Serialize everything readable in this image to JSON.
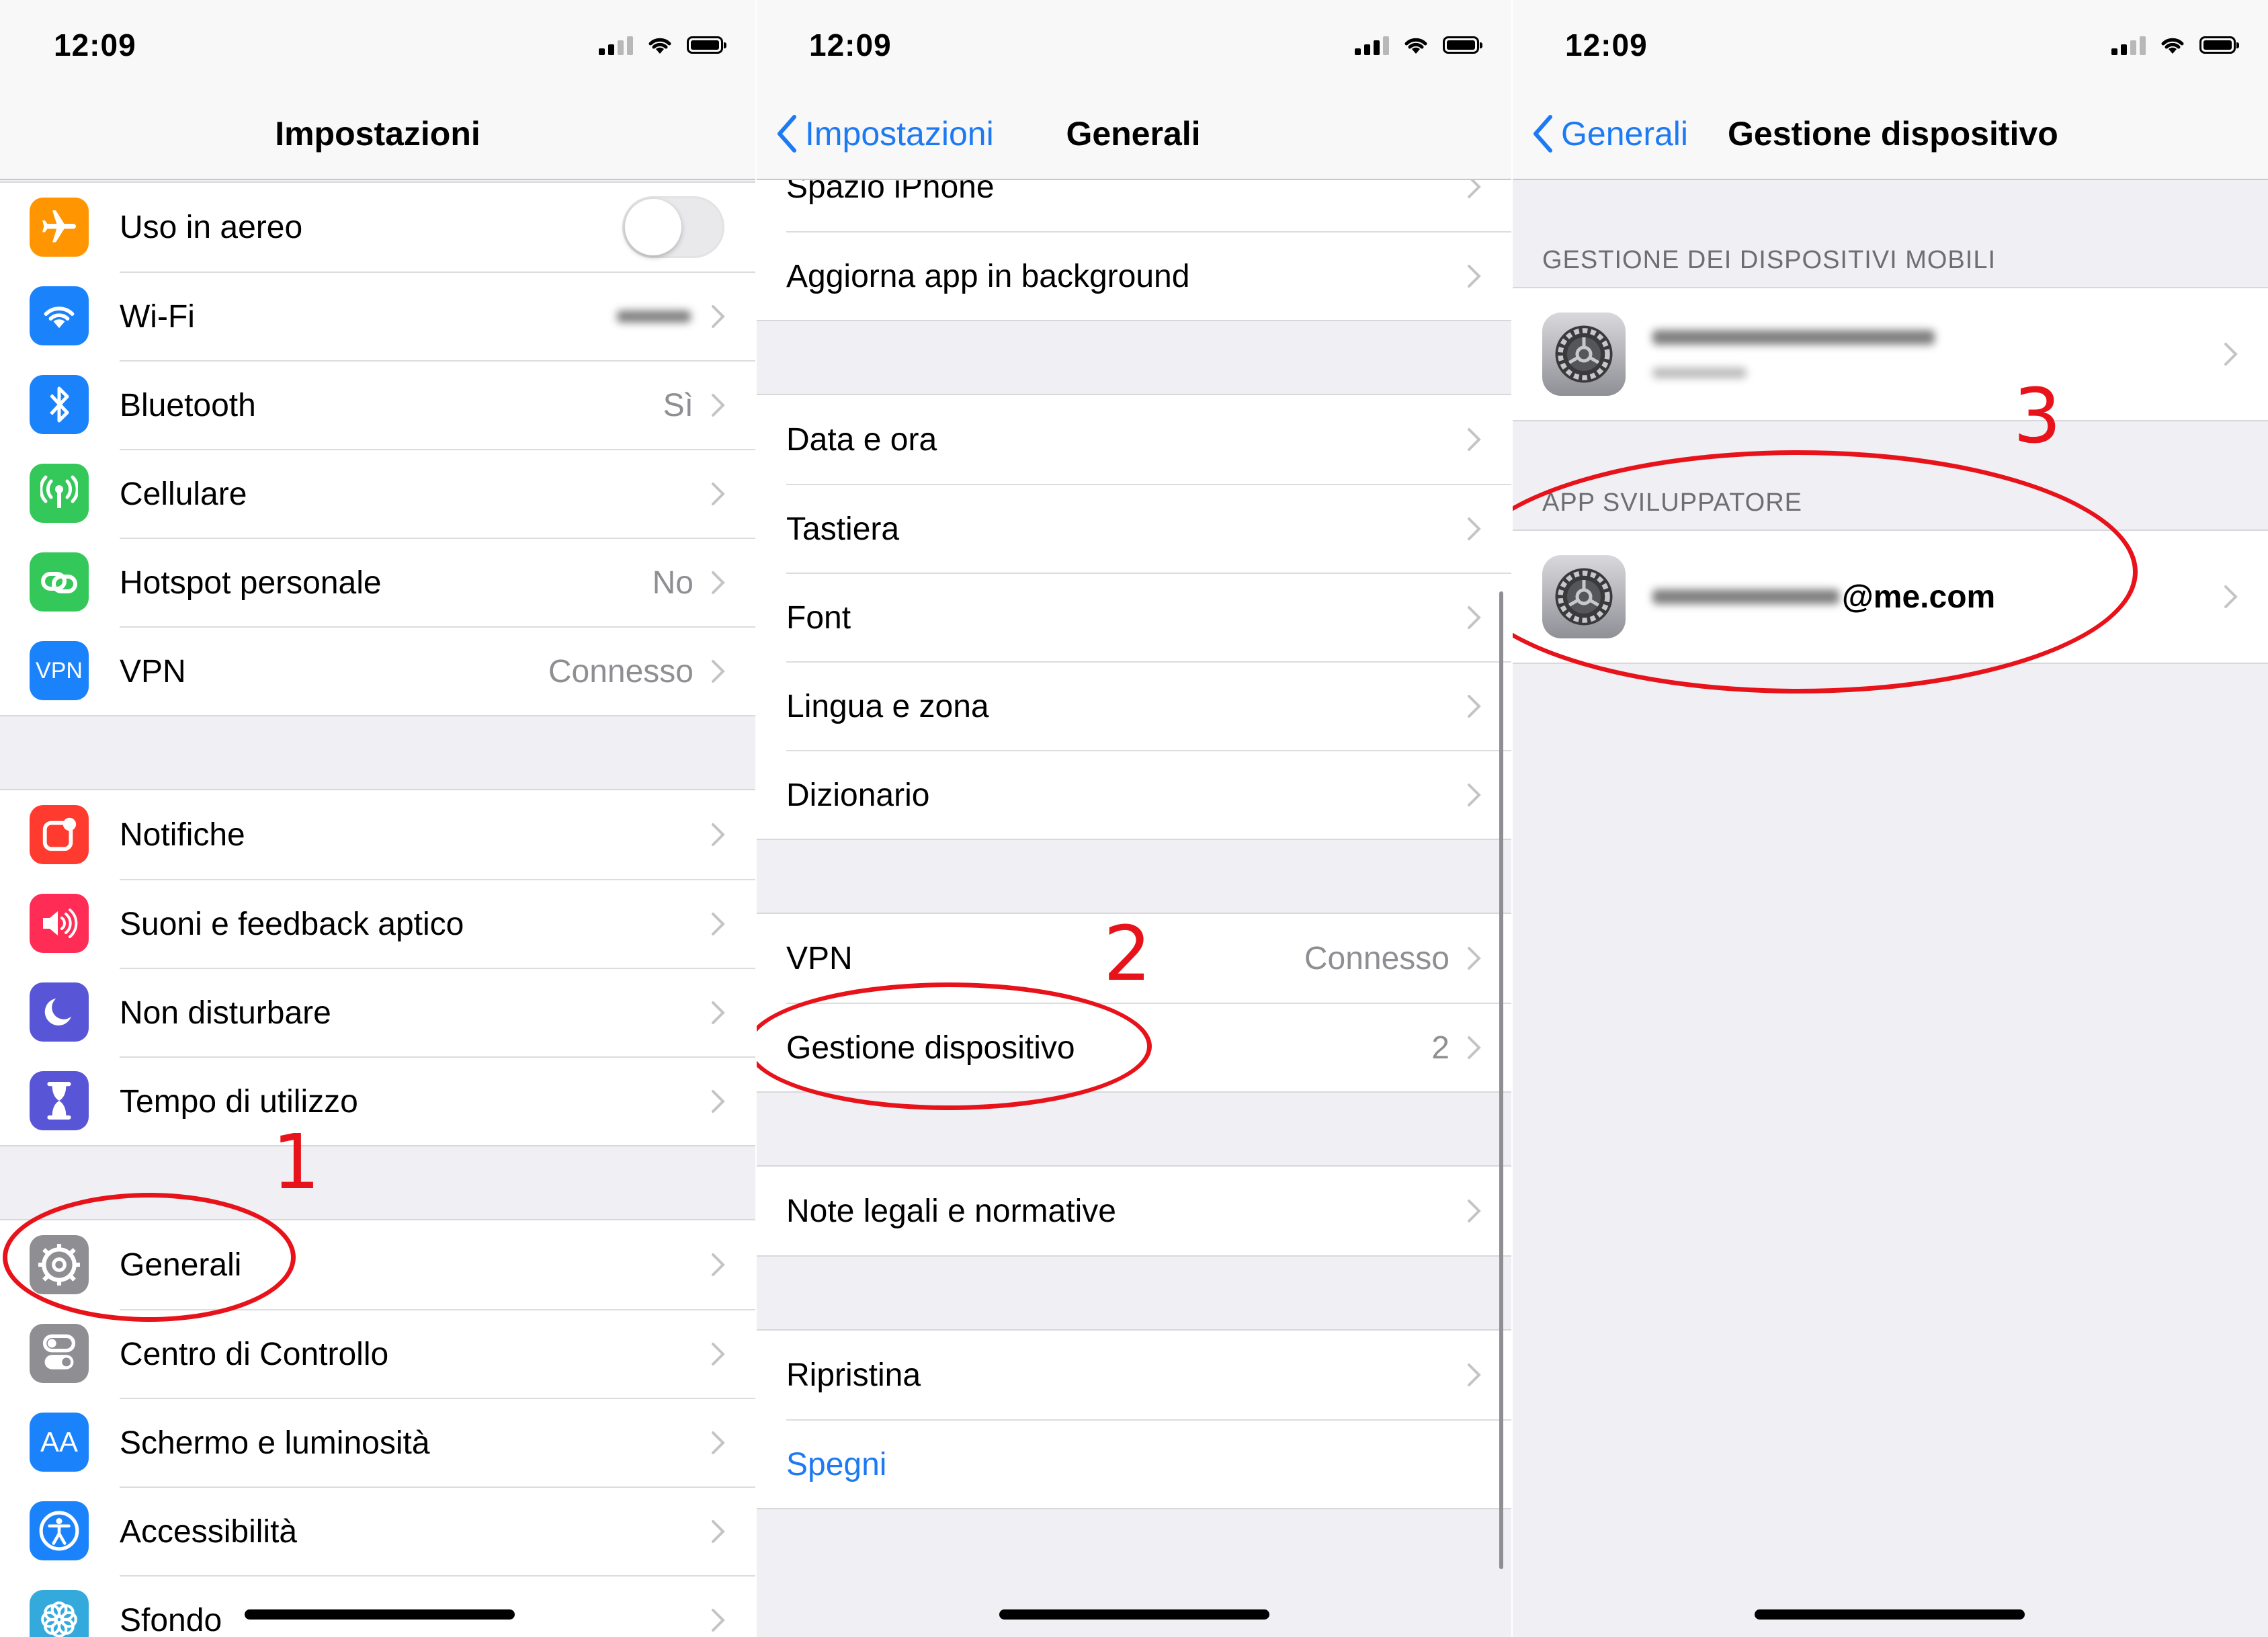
{
  "status": {
    "time": "12:09"
  },
  "p1": {
    "title": "Impostazioni",
    "group1": [
      {
        "label": "Uso in aereo",
        "value": "",
        "icon": "airplane-icon",
        "color": "#ff9500"
      },
      {
        "label": "Wi-Fi",
        "value": "",
        "icon": "wifi-icon",
        "color": "#1a82fb"
      },
      {
        "label": "Bluetooth",
        "value": "Sì",
        "icon": "bluetooth-icon",
        "color": "#1a82fb"
      },
      {
        "label": "Cellulare",
        "value": "",
        "icon": "cellular-icon",
        "color": "#34c759"
      },
      {
        "label": "Hotspot personale",
        "value": "No",
        "icon": "hotspot-icon",
        "color": "#34c759"
      },
      {
        "label": "VPN",
        "value": "Connesso",
        "icon": "vpn-icon",
        "icon_text": "VPN",
        "color": "#1a82fb"
      }
    ],
    "group2": [
      {
        "label": "Notifiche",
        "icon": "notifications-icon",
        "color": "#ff3b30"
      },
      {
        "label": "Suoni e feedback aptico",
        "icon": "sounds-icon",
        "color": "#ff2d55"
      },
      {
        "label": "Non disturbare",
        "icon": "moon-icon",
        "color": "#5856d6"
      },
      {
        "label": "Tempo di utilizzo",
        "icon": "hourglass-icon",
        "color": "#5856d6"
      }
    ],
    "group3": [
      {
        "label": "Generali",
        "icon": "gear-icon",
        "color": "#8e8e93"
      },
      {
        "label": "Centro di Controllo",
        "icon": "control-center-icon",
        "color": "#8e8e93"
      },
      {
        "label": "Schermo e luminosità",
        "icon": "display-icon",
        "icon_text": "AA",
        "color": "#1a82fb"
      },
      {
        "label": "Accessibilità",
        "icon": "accessibility-icon",
        "color": "#1a82fb"
      },
      {
        "label": "Sfondo",
        "icon": "wallpaper-icon",
        "color": "#34aadc"
      }
    ],
    "annotation": "1"
  },
  "p2": {
    "back": "Impostazioni",
    "title": "Generali",
    "group1": [
      {
        "label": "Spazio iPhone"
      },
      {
        "label": "Aggiorna app in background"
      }
    ],
    "group2": [
      {
        "label": "Data e ora"
      },
      {
        "label": "Tastiera"
      },
      {
        "label": "Font"
      },
      {
        "label": "Lingua e zona"
      },
      {
        "label": "Dizionario"
      }
    ],
    "group3": [
      {
        "label": "VPN",
        "value": "Connesso"
      },
      {
        "label": "Gestione dispositivo",
        "value": "2"
      }
    ],
    "group4": [
      {
        "label": "Note legali e normative"
      }
    ],
    "group5": [
      {
        "label": "Ripristina"
      },
      {
        "label": "Spegni"
      }
    ],
    "annotation": "2",
    "colors": {
      "link": "#1d7af3"
    }
  },
  "p3": {
    "back": "Generali",
    "title": "Gestione dispositivo",
    "section1": "GESTIONE DEI DISPOSITIVI MOBILI",
    "section2": "APP SVILUPPATORE",
    "developer_email_suffix": "@me.com",
    "annotation": "3"
  }
}
